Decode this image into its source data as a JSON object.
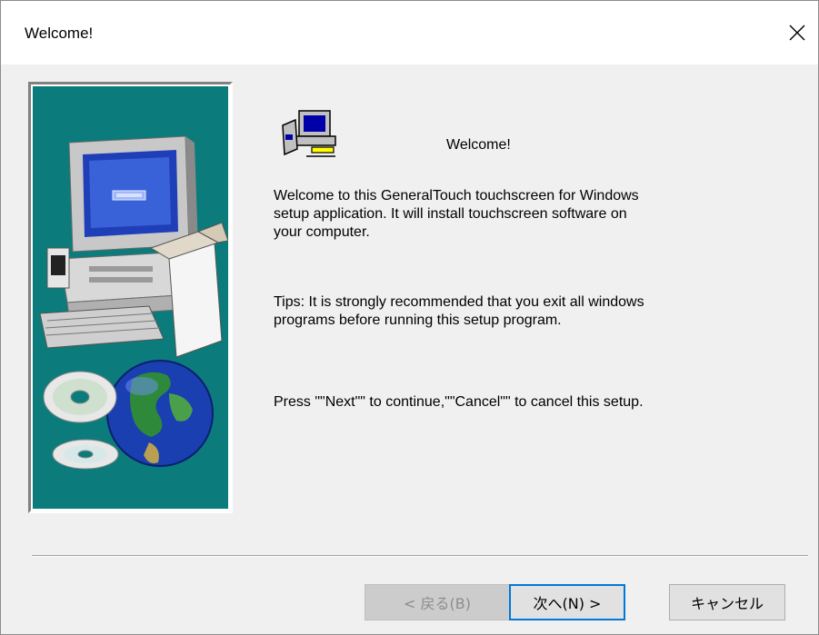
{
  "window": {
    "title": "Welcome!",
    "close_label": "✕"
  },
  "content": {
    "heading": "Welcome!",
    "paragraph1": "Welcome to this GeneralTouch touchscreen for Windows\nsetup application. It will install touchscreen software on\nyour computer.",
    "paragraph2": "Tips: It is strongly recommended that you exit all windows\nprograms before running this setup program.",
    "paragraph3": "Press \"\"Next\"\" to continue,\"\"Cancel\"\" to cancel this setup."
  },
  "buttons": {
    "back": "< 戻る(B)",
    "next": "次へ(N) >",
    "cancel": "キャンセル"
  },
  "icons": {
    "close": "close-icon",
    "setup": "setup-computer-icon",
    "illustration": "computer-globe-cd-illustration"
  },
  "colors": {
    "panel_background": "#0b7b7b",
    "focus_border": "#0078d7",
    "dialog_background": "#f0f0f0"
  },
  "state": {
    "back_enabled": false,
    "default_button": "next"
  }
}
